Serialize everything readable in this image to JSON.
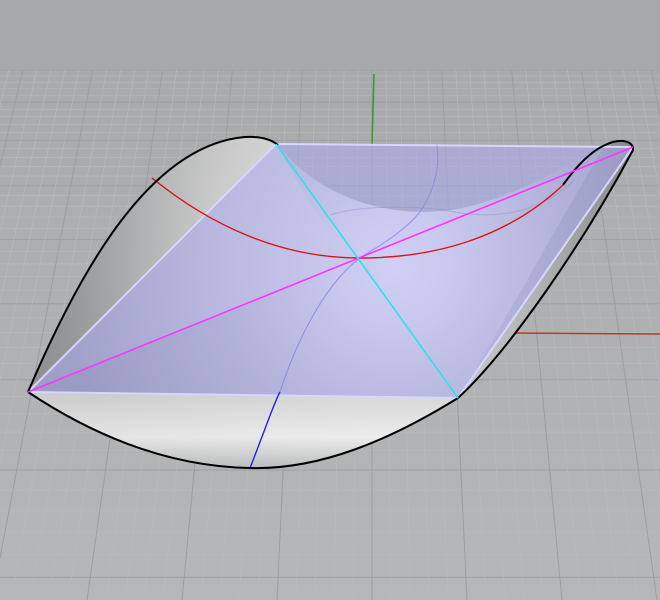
{
  "colors": {
    "background_top": "#a6a8aa",
    "background_bottom": "#b5b7b9",
    "grid_minor": "#b9bbbe",
    "grid_major": "#9c9ea1",
    "axis_x": "#b23a2e",
    "axis_y": "#2f9a2f",
    "surface_light": "#f7f7f7",
    "surface_dark": "#7f8183",
    "surface_edge": "#000000",
    "plane_fill": "#a9a9f0",
    "plane_edge": "#d6d6ff",
    "diagonal_line": "#ff33ff",
    "cyan_line": "#29e3ea",
    "red_curve": "#e01010",
    "blue_curve": "#2222dd"
  },
  "icons": {
    "surface": "saddle-surface-icon"
  }
}
